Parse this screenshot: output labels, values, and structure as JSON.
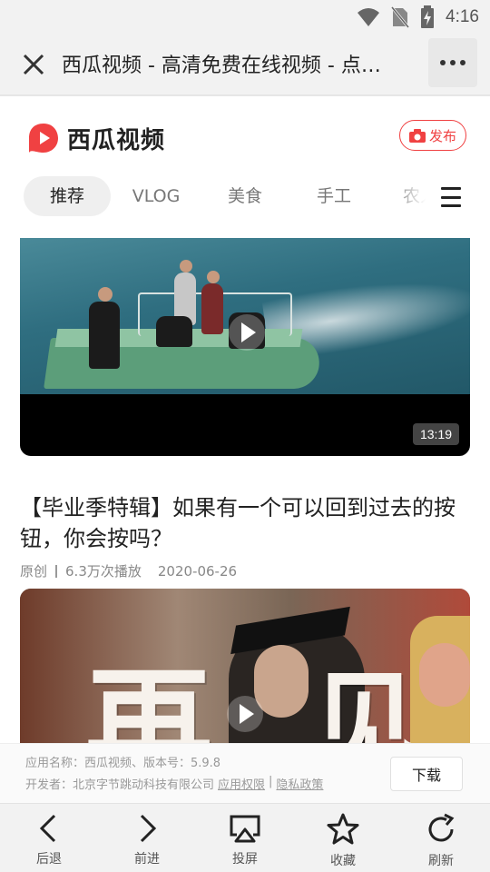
{
  "status_bar": {
    "time": "4:16"
  },
  "title_bar": {
    "title": "西瓜视频 - 高清免费在线视频 - 点…"
  },
  "site": {
    "logo_text": "西瓜视频",
    "publish_label": "发布",
    "tabs": [
      {
        "label": "推荐",
        "active": true
      },
      {
        "label": "VLOG",
        "active": false
      },
      {
        "label": "美食",
        "active": false
      },
      {
        "label": "手工",
        "active": false
      },
      {
        "label": "农人",
        "active": false
      }
    ]
  },
  "feed": {
    "video1": {
      "duration": "13:19"
    },
    "video2": {
      "title": "【毕业季特辑】如果有一个可以回到过去的按钮，你会按吗？",
      "source": "原创",
      "views": "6.3万次播放",
      "date": "2020-06-26"
    }
  },
  "app_banner": {
    "info_line1": "应用名称：西瓜视频、版本号：5.9.8",
    "developer": "开发者：北京字节跳动科技有限公司",
    "permissions_link": "应用权限",
    "separator": "|",
    "privacy_link": "隐私政策",
    "download_label": "下载"
  },
  "nav_bar": {
    "back": "后退",
    "forward": "前进",
    "cast": "投屏",
    "favorite": "收藏",
    "refresh": "刷新"
  },
  "colors": {
    "brand_red": "#f04142",
    "tab_active_bg": "#efefef"
  }
}
